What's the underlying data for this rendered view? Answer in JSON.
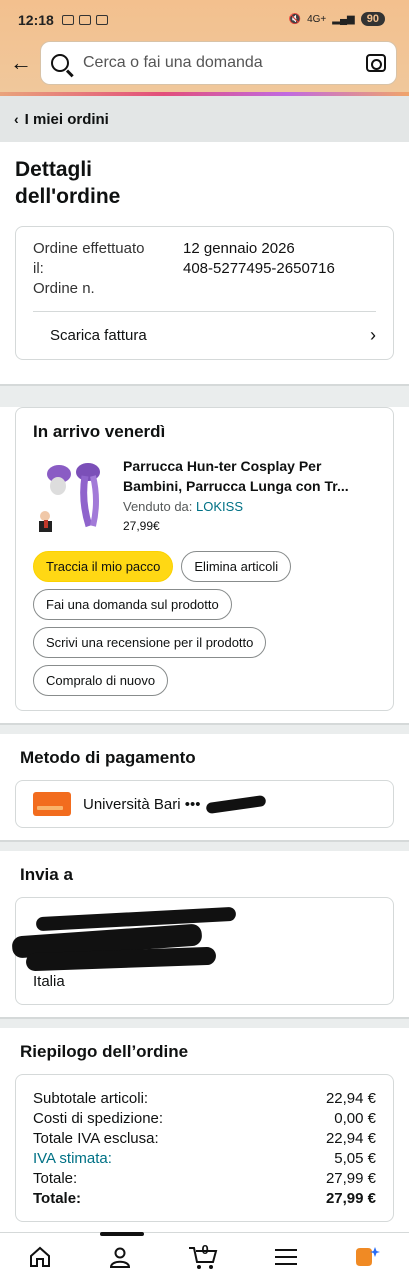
{
  "status_bar": {
    "time": "12:18",
    "battery": "90",
    "network": "4G+"
  },
  "search": {
    "placeholder": "Cerca o fai una domanda"
  },
  "breadcrumb": {
    "label": "I miei ordini"
  },
  "page": {
    "title_line1": "Dettagli",
    "title_line2": "dell'ordine"
  },
  "order": {
    "placed_label_1": "Ordine effettuato",
    "placed_label_2": "il:",
    "number_label": "Ordine n.",
    "date": "12 gennaio 2026",
    "number": "408-5277495-2650716",
    "invoice_label": "Scarica fattura"
  },
  "shipment": {
    "heading": "In arrivo venerdì",
    "product_title_1": "Parrucca Hun-ter Cosplay Per",
    "product_title_2": "Bambini, Parrucca Lunga con Tr...",
    "seller_label": "Venduto da:",
    "seller_name": "LOKISS",
    "price": "27,99€",
    "buttons": {
      "track": "Traccia il mio pacco",
      "delete": "Elimina articoli",
      "ask": "Fai una domanda sul prodotto",
      "review": "Scrivi una recensione per il prodotto",
      "buy_again": "Compralo di nuovo"
    }
  },
  "payment": {
    "heading": "Metodo di pagamento",
    "method": "Università Bari •••"
  },
  "shipping_address": {
    "heading": "Invia a",
    "country": "Italia"
  },
  "summary": {
    "heading": "Riepilogo dell’ordine",
    "rows": [
      {
        "label": "Subtotale articoli:",
        "value": "22,94 €"
      },
      {
        "label": "Costi di spedizione:",
        "value": "0,00 €"
      },
      {
        "label": "Totale IVA esclusa:",
        "value": "22,94 €"
      },
      {
        "label": "IVA stimata:",
        "value": "5,05 €"
      },
      {
        "label": "Totale:",
        "value": "27,99 €"
      },
      {
        "label": "Totale:",
        "value": "27,99 €"
      }
    ]
  },
  "bottom_nav": {
    "cart_count": "0"
  },
  "colors": {
    "primary_button": "#ffd814",
    "link": "#007185",
    "header": "#f3c08e"
  }
}
